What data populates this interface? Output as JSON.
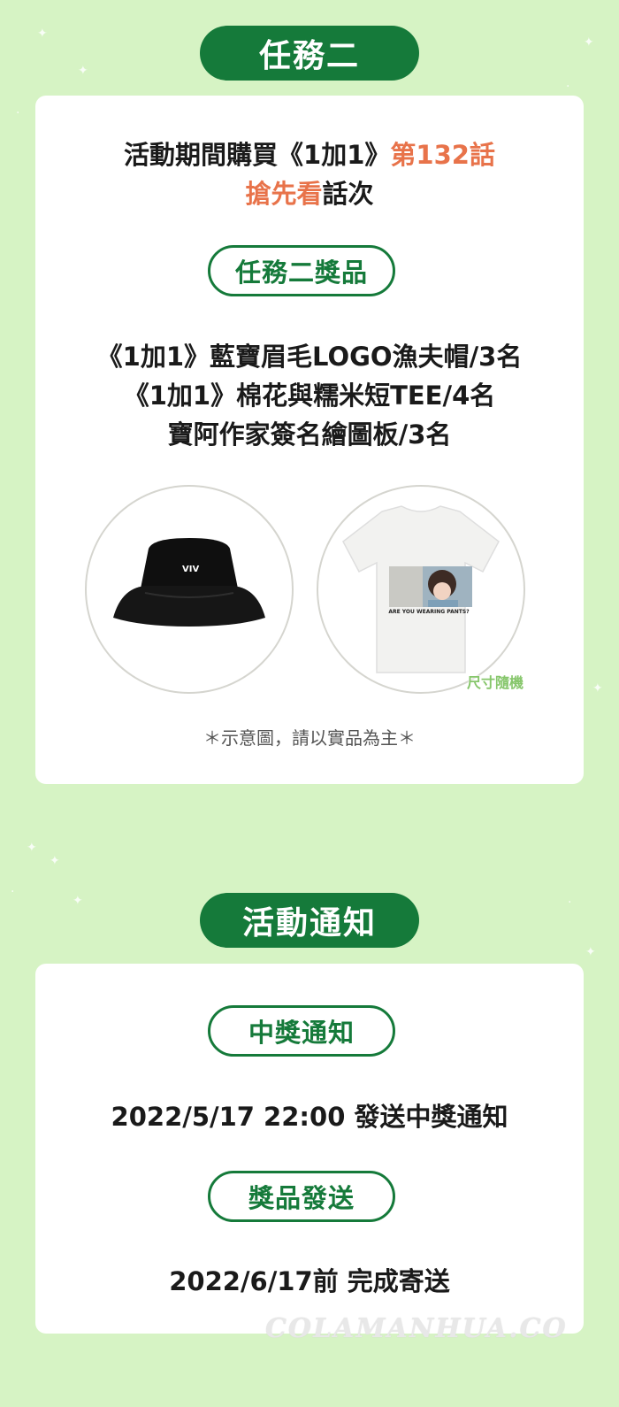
{
  "mission2": {
    "title": "任務二",
    "description_line1_prefix": "活動期間購買《1加1》",
    "description_line1_highlight": "第132話",
    "description_line2_highlight": "搶先看",
    "description_line2_suffix": "話次",
    "prize_pill": "任務二獎品",
    "prizes": [
      "《1加1》藍寶眉毛LOGO漁夫帽/3名",
      "《1加1》棉花與糯米短TEE/4名",
      "寶阿作家簽名繪圖板/3名"
    ],
    "tshirt_caption": "ARE YOU WEARING PANTS?",
    "size_tag": "尺寸隨機",
    "disclaimer": "＊示意圖，請以實品為主＊"
  },
  "notice": {
    "title": "活動通知",
    "winner_pill": "中獎通知",
    "winner_text": "2022/5/17 22:00 發送中獎通知",
    "shipping_pill": "獎品發送",
    "shipping_text": "2022/6/17前 完成寄送"
  },
  "watermark": "COLAMANHUA.CO",
  "colors": {
    "background": "#d6f3c4",
    "primary_green": "#157a3a",
    "accent_orange": "#e8734a",
    "card": "#ffffff"
  }
}
